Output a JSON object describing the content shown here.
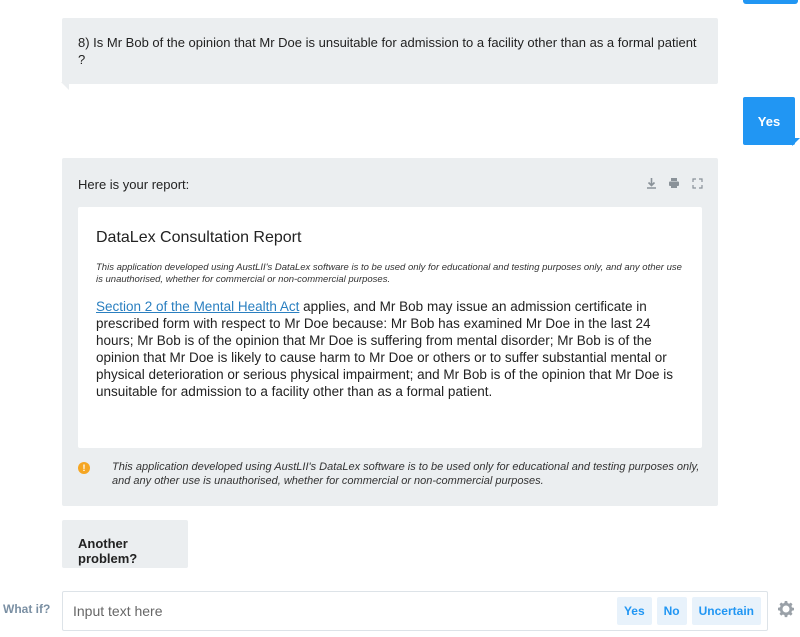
{
  "question": {
    "text": "8) Is Mr Bob of the opinion that Mr Doe is unsuitable for admission to a facility other than as a formal patient ?"
  },
  "user_reply": {
    "text": "Yes"
  },
  "report": {
    "intro": "Here is your report:",
    "tools": [
      "download-icon",
      "print-icon",
      "expand-icon"
    ],
    "title": "DataLex Consultation Report",
    "disclaimer": "This application developed using AustLII's DataLex software is to be used only for educational and testing purposes only, and any other use is unauthorised, whether for commercial or non-commercial purposes.",
    "link_text": "Section 2 of the Mental Health Act",
    "body": " applies, and Mr Bob may issue an admission certificate in prescribed form with respect to Mr Doe because: Mr Bob has examined Mr Doe in the last 24 hours; Mr Bob is of the opinion that Mr Doe is suffering from mental disorder; Mr Bob is of the opinion that Mr Doe is likely to cause harm to Mr Doe or others or to suffer substantial mental or physical deterioration or serious physical impairment; and Mr Bob is of the opinion that Mr Doe is unsuitable for admission to a facility other than as a formal patient.",
    "warning": "This application developed using AustLII's DataLex software is to be used only for educational and testing purposes only, and any other use is unauthorised, whether for commercial or non-commercial purposes."
  },
  "followup": {
    "text": "Another problem?"
  },
  "input_bar": {
    "whatif_label": "What if?",
    "placeholder": "Input text here",
    "value": "",
    "quick_replies": [
      "Yes",
      "No",
      "Uncertain"
    ]
  },
  "colors": {
    "accent": "#2196f3",
    "bubble": "#ebeef0",
    "warning": "#f5a623"
  }
}
